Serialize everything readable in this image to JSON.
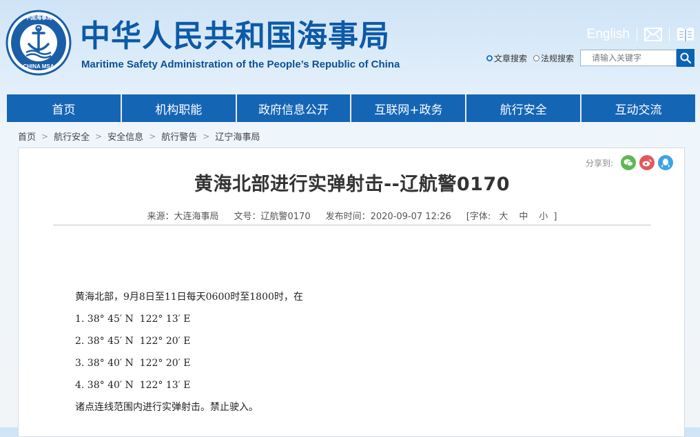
{
  "header": {
    "title_cn": "中华人民共和国海事局",
    "title_en": "Maritime Safety Administration of the People’s Republic of China",
    "logo_text_top": "中国海事局",
    "logo_text_bottom": "CHINA MSA",
    "english_link": "English",
    "icons": [
      "mail-icon",
      "book-icon"
    ]
  },
  "search": {
    "options": [
      "文章搜索",
      "法规搜索"
    ],
    "selected": "文章搜索",
    "placeholder": "请输入关键字",
    "value": ""
  },
  "nav": {
    "items": [
      "首页",
      "机构职能",
      "政府信息公开",
      "互联网+政务",
      "航行安全",
      "互动交流"
    ]
  },
  "breadcrumb": [
    "首页",
    "航行安全",
    "安全信息",
    "航行警告",
    "辽宁海事局"
  ],
  "article": {
    "share_label": "分享到:",
    "share_icons": [
      "wechat-icon",
      "weibo-icon",
      "qq-icon"
    ],
    "title": "黄海北部进行实弹射击--辽航警0170",
    "source": "来源：大连海事局",
    "doc_no": "文号：辽航警0170",
    "publish_time": "发布时间：2020-09-07 12:26",
    "font_label": "[字体:",
    "font_sizes": [
      "大",
      "中",
      "小"
    ],
    "font_close": "]",
    "paragraphs": [
      "黄海北部，9月8日至11日每天0600时至1800时，在",
      "1. 38° 45′ N  122° 13′ E",
      "2. 38° 45′ N  122° 20′ E",
      "3. 38° 40′ N  122° 20′ E",
      "4. 38° 40′ N  122° 13′ E",
      "诸点连线范围内进行实弹射击。禁止驶入。"
    ]
  },
  "colors": {
    "brand_blue": "#0d5aa7",
    "nav_blue": "#1565b5",
    "wechat": "#5fb856",
    "weibo": "#e2585d",
    "qq": "#3ba3e6"
  }
}
